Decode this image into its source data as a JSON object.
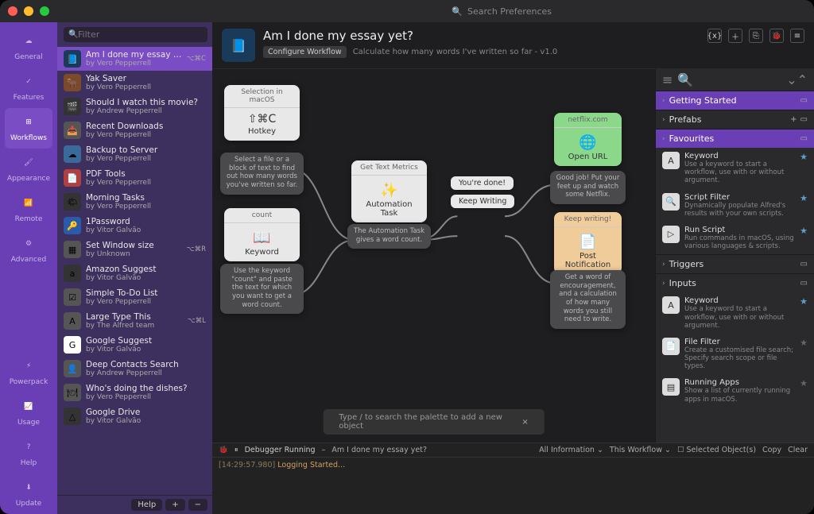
{
  "topSearchPlaceholder": "Search Preferences",
  "sidebar": [
    {
      "label": "General",
      "glyph": "☁"
    },
    {
      "label": "Features",
      "glyph": "✓"
    },
    {
      "label": "Workflows",
      "glyph": "⊞"
    },
    {
      "label": "Appearance",
      "glyph": "🖌"
    },
    {
      "label": "Remote",
      "glyph": "📶"
    },
    {
      "label": "Advanced",
      "glyph": "⚙"
    },
    {
      "label": "Powerpack",
      "glyph": "⚡"
    },
    {
      "label": "Usage",
      "glyph": "📈"
    },
    {
      "label": "Help",
      "glyph": "?"
    },
    {
      "label": "Update",
      "glyph": "⬇"
    }
  ],
  "sidebarActive": "Workflows",
  "wfFilterPlaceholder": "Filter",
  "workflows": [
    {
      "name": "Am I done my essay yet?",
      "author": "by Vero Pepperrell",
      "shortcut": "⌥⌘C",
      "icon": "📘",
      "iconBg": "#1a3a5a"
    },
    {
      "name": "Yak Saver",
      "author": "by Vero Pepperrell",
      "icon": "🐂",
      "iconBg": "#7a4a2a"
    },
    {
      "name": "Should I watch this movie?",
      "author": "by Andrew Pepperrell",
      "icon": "🎬",
      "iconBg": "#333"
    },
    {
      "name": "Recent Downloads",
      "author": "by Vero Pepperrell",
      "icon": "📥",
      "iconBg": "#555"
    },
    {
      "name": "Backup to Server",
      "author": "by Vero Pepperrell",
      "icon": "☁",
      "iconBg": "#3a6a9a"
    },
    {
      "name": "PDF Tools",
      "author": "by Vero Pepperrell",
      "icon": "📄",
      "iconBg": "#b04040"
    },
    {
      "name": "Morning Tasks",
      "author": "by Vero Pepperrell",
      "icon": "🌤",
      "iconBg": "#333"
    },
    {
      "name": "1Password",
      "author": "by Vitor Galvão",
      "icon": "🔑",
      "iconBg": "#2a5aaa"
    },
    {
      "name": "Set Window size",
      "author": "by Unknown",
      "shortcut": "⌥⌘R",
      "icon": "▦",
      "iconBg": "#555"
    },
    {
      "name": "Amazon Suggest",
      "author": "by Vitor Galvão",
      "icon": "a",
      "iconBg": "#333"
    },
    {
      "name": "Simple To-Do List",
      "author": "by Vero Pepperrell",
      "icon": "☑",
      "iconBg": "#555"
    },
    {
      "name": "Large Type This",
      "author": "by The Alfred team",
      "shortcut": "⌥⌘L",
      "icon": "A",
      "iconBg": "#555"
    },
    {
      "name": "Google Suggest",
      "author": "by Vitor Galvão",
      "icon": "G",
      "iconBg": "#fff"
    },
    {
      "name": "Deep Contacts Search",
      "author": "by Andrew Pepperrell",
      "icon": "👤",
      "iconBg": "#555"
    },
    {
      "name": "Who's doing the dishes?",
      "author": "by Vero Pepperrell",
      "icon": "🍽",
      "iconBg": "#555"
    },
    {
      "name": "Google Drive",
      "author": "by Vitor Galvão",
      "icon": "△",
      "iconBg": "#333"
    }
  ],
  "wfFooter": {
    "help": "Help",
    "plus": "+",
    "minus": "−"
  },
  "header": {
    "title": "Am I done my essay yet?",
    "configure": "Configure Workflow",
    "desc": "Calculate how many words I've written so far - v1.0",
    "tools": [
      "{x}",
      "＋",
      "⎘",
      "🐞",
      "≡"
    ]
  },
  "nodes": {
    "hotkey": {
      "top": "Selection in macOS",
      "key": "⇧⌘C",
      "label": "Hotkey",
      "desc": "Select a file or a block of text to find out how many words you've written so far."
    },
    "keyword": {
      "top": "count",
      "icon": "📖",
      "label": "Keyword",
      "desc": "Use the keyword \"count\" and paste the text for which you want to get a word count."
    },
    "task": {
      "top": "Get Text Metrics",
      "icon": "✨",
      "label": "Automation Task",
      "desc": "The Automation Task gives a word count."
    },
    "branch1": "You're done!",
    "branch2": "Keep Writing",
    "url": {
      "top": "netflix.com",
      "icon": "🌐",
      "label": "Open URL",
      "desc": "Good job! Put your feet up and watch some Netflix."
    },
    "notif": {
      "top": "Keep writing!",
      "icon": "📄",
      "label": "Post Notification",
      "desc": "Get a word of encouragement, and a calculation of how many words you still need to write."
    }
  },
  "palette": "Type / to search the palette to add a new object",
  "inspector": {
    "sections": [
      {
        "title": "Getting Started",
        "type": "purple",
        "tools": [
          "▭"
        ]
      },
      {
        "title": "Prefabs",
        "tools": [
          "+",
          "▭"
        ]
      },
      {
        "title": "Favourites",
        "type": "purple",
        "tools": [
          "▭"
        ]
      },
      {
        "title": "Triggers",
        "tools": [
          "▭"
        ]
      },
      {
        "title": "Inputs",
        "tools": [
          "▭"
        ]
      }
    ],
    "favourites": [
      {
        "name": "Keyword",
        "desc": "Use a keyword to start a workflow, use with or without argument.",
        "icon": "A",
        "star": true
      },
      {
        "name": "Script Filter",
        "desc": "Dynamically populate Alfred's results with your own scripts.",
        "icon": "🔍",
        "star": true
      },
      {
        "name": "Run Script",
        "desc": "Run commands in macOS, using various languages & scripts.",
        "icon": "▷",
        "star": true
      }
    ],
    "inputs": [
      {
        "name": "Keyword",
        "desc": "Use a keyword to start a workflow, use with or without argument.",
        "icon": "A",
        "star": true
      },
      {
        "name": "File Filter",
        "desc": "Create a customised file search; Specify search scope or file types.",
        "icon": "📄",
        "star": false
      },
      {
        "name": "Running Apps",
        "desc": "Show a list of currently running apps in macOS.",
        "icon": "▤",
        "star": false
      }
    ]
  },
  "debugger": {
    "status": "Debugger Running",
    "context": "Am I done my essay yet?",
    "info": "All Information",
    "scope": "This Workflow",
    "selected": "Selected Object(s)",
    "copy": "Copy",
    "clear": "Clear",
    "time": "[14:29:57.980]",
    "msg": "Logging Started..."
  }
}
